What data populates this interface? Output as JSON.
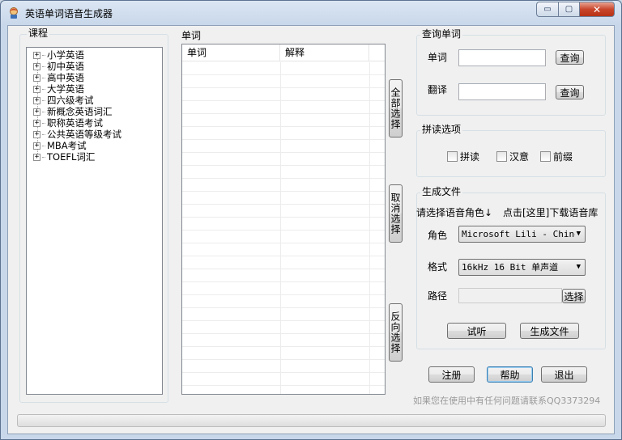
{
  "window": {
    "title": "英语单词语音生成器"
  },
  "caption": {
    "min": "▭",
    "max": "▢",
    "close": "✕"
  },
  "course": {
    "title": "课程",
    "items": [
      {
        "label": "小学英语"
      },
      {
        "label": "初中英语"
      },
      {
        "label": "高中英语"
      },
      {
        "label": "大学英语"
      },
      {
        "label": "四六级考试"
      },
      {
        "label": "新概念英语词汇"
      },
      {
        "label": "职称英语考试"
      },
      {
        "label": "公共英语等级考试"
      },
      {
        "label": "MBA考试"
      },
      {
        "label": "TOEFL词汇"
      }
    ]
  },
  "words": {
    "title": "单词",
    "columns": [
      "单词",
      "解释"
    ]
  },
  "side_buttons": {
    "select_all": "全部选择",
    "cancel_select": "取消选择",
    "invert_select": "反向选择"
  },
  "query": {
    "title": "查询单词",
    "word_label": "单词",
    "translate_label": "翻译",
    "word_value": "",
    "translate_value": "",
    "query_button": "查询"
  },
  "spell": {
    "title": "拼读选项",
    "options": [
      "拼读",
      "汉意",
      "前缀"
    ]
  },
  "generate": {
    "title": "生成文件",
    "hint": "请选择语音角色↓",
    "download_link": "点击[这里]下载语音库",
    "role_label": "角色",
    "role_value": "Microsoft Lili - Chinese",
    "format_label": "格式",
    "format_value": "16kHz 16 Bit 单声道",
    "path_label": "路径",
    "path_value": "",
    "browse_button": "选择",
    "preview_button": "试听",
    "generate_button": "生成文件"
  },
  "bottom": {
    "register": "注册",
    "help": "帮助",
    "exit": "退出",
    "contact": "如果您在使用中有任何问题请联系QQ3373294"
  },
  "progress": {
    "value": 0
  },
  "colors": {
    "accent": "#3c7fb1",
    "window_border": "#5c728f"
  }
}
